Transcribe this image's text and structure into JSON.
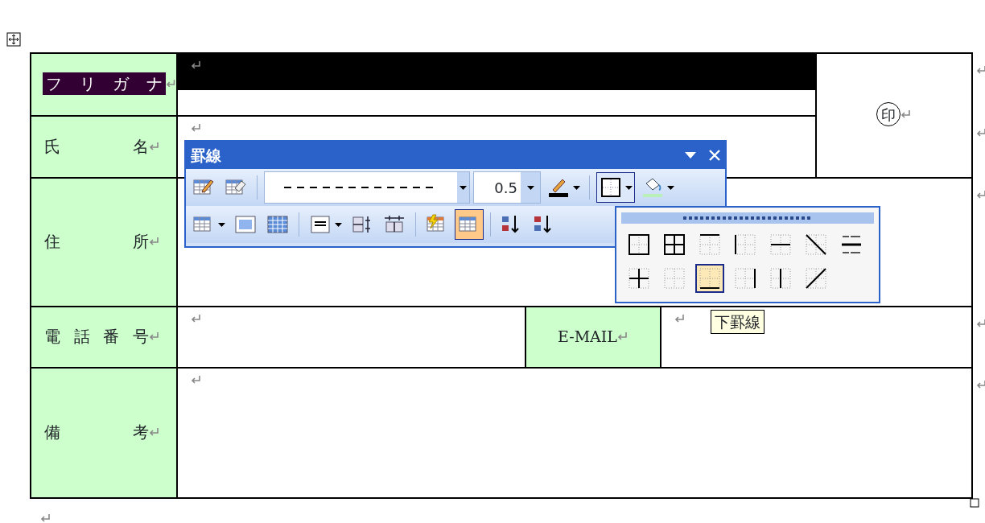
{
  "document": {
    "table": {
      "rows": [
        {
          "kind": "furigana",
          "label": "フリガナ",
          "selected": true
        },
        {
          "kind": "name",
          "label": "氏名",
          "selected": false
        },
        {
          "kind": "address",
          "label": "住所",
          "selected": false
        },
        {
          "kind": "phone",
          "label": "電話番号",
          "selected": false,
          "email_label": "E-MAIL"
        },
        {
          "kind": "notes",
          "label": "備考",
          "selected": false
        }
      ],
      "seal": "印"
    }
  },
  "borders_toolbar": {
    "title": "罫線",
    "rows": [
      [
        {
          "kind": "draw_table",
          "selected": false
        },
        {
          "kind": "eraser",
          "selected": false
        },
        {
          "kind": "separator"
        },
        {
          "kind": "line_style",
          "dashed": true
        },
        {
          "kind": "line_weight",
          "value": "0.5"
        },
        {
          "kind": "pen_color",
          "expanded": false
        },
        {
          "kind": "separator"
        },
        {
          "kind": "borders",
          "expanded": true
        },
        {
          "kind": "shading",
          "expanded": false
        }
      ],
      [
        {
          "kind": "insert_table",
          "expanded": false
        },
        {
          "kind": "merge_cells",
          "selected": false
        },
        {
          "kind": "split_cells",
          "selected": false
        },
        {
          "kind": "separator"
        },
        {
          "kind": "align",
          "expanded": false
        },
        {
          "kind": "distribute_rows",
          "selected": false
        },
        {
          "kind": "distribute_columns",
          "selected": false
        },
        {
          "kind": "separator"
        },
        {
          "kind": "autoformat",
          "selected": false
        },
        {
          "kind": "gridlines",
          "selected": true
        },
        {
          "kind": "separator"
        },
        {
          "kind": "sort_ascending",
          "selected": false
        },
        {
          "kind": "sort_descending",
          "selected": false
        }
      ]
    ]
  },
  "border_menu": {
    "items": [
      {
        "kind": "outside",
        "selected": false
      },
      {
        "kind": "all",
        "selected": false
      },
      {
        "kind": "top",
        "selected": false
      },
      {
        "kind": "left",
        "selected": false
      },
      {
        "kind": "inside_horizontal",
        "selected": false
      },
      {
        "kind": "diagonal_down",
        "selected": false
      },
      {
        "kind": "horizontal_line",
        "selected": false
      },
      {
        "kind": "inside",
        "selected": false
      },
      {
        "kind": "none",
        "selected": false
      },
      {
        "kind": "bottom",
        "selected": true
      },
      {
        "kind": "right",
        "selected": false
      },
      {
        "kind": "inside_vertical",
        "selected": false
      },
      {
        "kind": "diagonal_up",
        "selected": false
      }
    ]
  },
  "tooltip": {
    "text": "下罫線"
  }
}
